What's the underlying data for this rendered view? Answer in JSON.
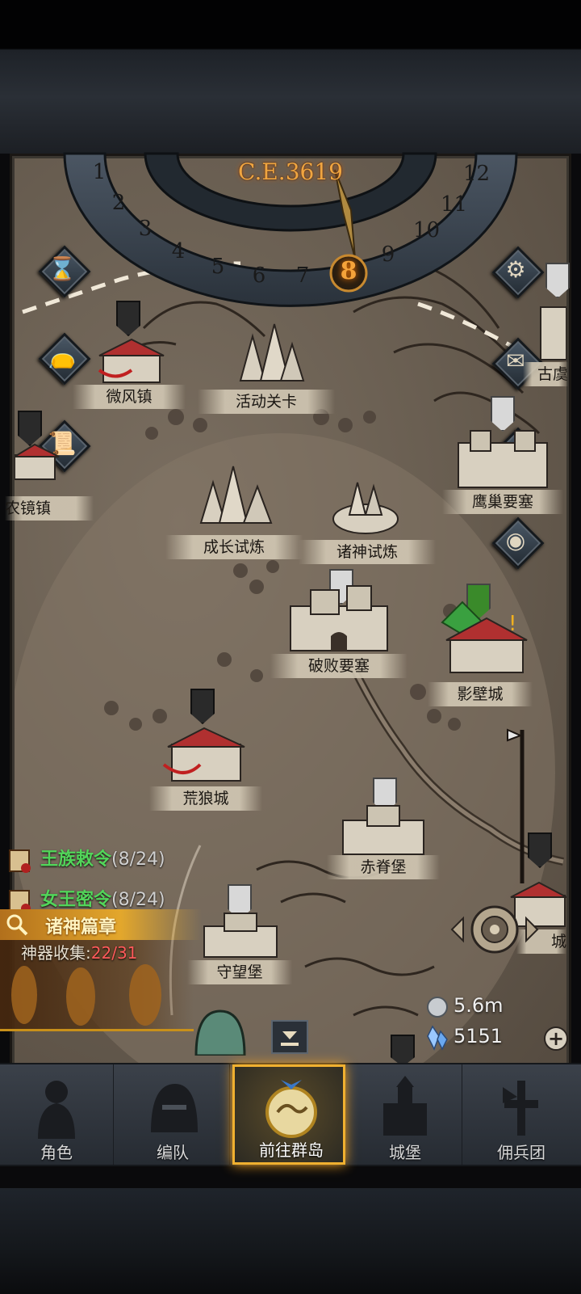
{
  "calendar": {
    "year": "C.E.3619",
    "months": [
      "1",
      "2",
      "3",
      "4",
      "5",
      "6",
      "7",
      "8",
      "9",
      "10",
      "11",
      "12"
    ],
    "current_month": "8"
  },
  "locations": [
    {
      "key": "weifeng",
      "label": "微风镇"
    },
    {
      "key": "event",
      "label": "活动关卡"
    },
    {
      "key": "nongjing",
      "label": "农镜镇"
    },
    {
      "key": "growth",
      "label": "成长试炼"
    },
    {
      "key": "gods",
      "label": "诸神试炼"
    },
    {
      "key": "eagle",
      "label": "鹰巢要塞"
    },
    {
      "key": "ruined",
      "label": "破败要塞"
    },
    {
      "key": "shadow",
      "label": "影壁城"
    },
    {
      "key": "wolf",
      "label": "荒狼城"
    },
    {
      "key": "red",
      "label": "赤脊堡"
    },
    {
      "key": "watch",
      "label": "守望堡"
    },
    {
      "key": "east_top",
      "label": "古虞"
    },
    {
      "key": "east_bottom",
      "label": "城"
    }
  ],
  "quests": [
    {
      "name": "王族敕令",
      "count": "(8/24)"
    },
    {
      "name": "女王密令",
      "count": "(8/24)"
    }
  ],
  "chapter": {
    "title": "诸神篇章",
    "artifact_label": "神器收集:",
    "artifact_value": "22/31"
  },
  "resources": {
    "silver": "5.6m",
    "crystal": "5151"
  },
  "nav": [
    {
      "label": "角色",
      "icon": "knight-icon"
    },
    {
      "label": "编队",
      "icon": "helmet-icon"
    },
    {
      "label": "前往群岛",
      "icon": "island-compass-icon"
    },
    {
      "label": "城堡",
      "icon": "castle-icon"
    },
    {
      "label": "佣兵团",
      "icon": "mercenary-icon"
    }
  ],
  "colors": {
    "accent": "#f0a540",
    "quest_green": "#52d55a",
    "artifact_red": "#ff5a5a"
  }
}
